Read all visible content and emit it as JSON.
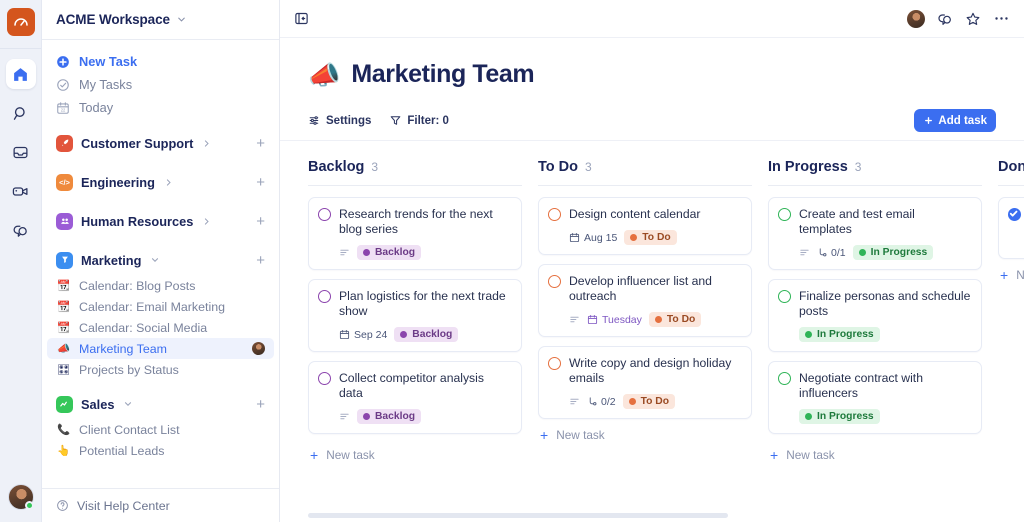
{
  "brand": {
    "logo_color": "#d4551d",
    "logo_icon": "speedometer-icon"
  },
  "rail": {
    "items": [
      {
        "name": "home-icon",
        "label": "Home",
        "active": true
      },
      {
        "name": "search-icon",
        "label": "Search",
        "active": false
      },
      {
        "name": "inbox-icon",
        "label": "Inbox",
        "active": false
      },
      {
        "name": "clips-video-icon",
        "label": "Clips",
        "active": false
      },
      {
        "name": "chat-help-icon",
        "label": "Chat",
        "active": false
      }
    ]
  },
  "sidebar": {
    "workspace": {
      "name": "ACME Workspace",
      "chevron": "chevron-down-icon"
    },
    "quick_links": [
      {
        "label": "New Task",
        "icon": "plus-circle-icon",
        "accent": true
      },
      {
        "label": "My Tasks",
        "icon": "check-circle-icon",
        "accent": false
      },
      {
        "label": "Today",
        "icon": "calendar-icon",
        "accent": false
      }
    ],
    "spaces": [
      {
        "label": "Customer Support",
        "icon_glyph": "✈",
        "icon_color": "#e2553c",
        "expanded": false,
        "chevron": "chevron-right-icon",
        "children": []
      },
      {
        "label": "Engineering",
        "icon_glyph": "</>",
        "icon_color": "#ef8a3c",
        "expanded": false,
        "chevron": "chevron-right-icon",
        "children": []
      },
      {
        "label": "Human Resources",
        "icon_glyph": "⚇",
        "icon_color": "#9b5cd6",
        "expanded": false,
        "chevron": "chevron-right-icon",
        "children": []
      },
      {
        "label": "Marketing",
        "icon_glyph": "⚐",
        "icon_color": "#3b8ef0",
        "expanded": true,
        "chevron": "chevron-down-icon",
        "children": [
          {
            "label": "Calendar: Blog Posts",
            "emoji": "📆",
            "selected": false,
            "avatar": false
          },
          {
            "label": "Calendar: Email Marketing",
            "emoji": "📆",
            "selected": false,
            "avatar": false
          },
          {
            "label": "Calendar: Social Media",
            "emoji": "📆",
            "selected": false,
            "avatar": false
          },
          {
            "label": "Marketing Team",
            "emoji": "📣",
            "selected": true,
            "avatar": true
          },
          {
            "label": "Projects by Status",
            "emoji": "🎛",
            "selected": false,
            "avatar": false
          }
        ]
      },
      {
        "label": "Sales",
        "icon_glyph": "〜",
        "icon_color": "#35c75a",
        "expanded": true,
        "chevron": "chevron-down-icon",
        "children": [
          {
            "label": "Client Contact List",
            "emoji": "📞",
            "selected": false,
            "avatar": false
          },
          {
            "label": "Potential Leads",
            "emoji": "👆",
            "selected": false,
            "avatar": false
          }
        ]
      }
    ],
    "footer": {
      "label": "Visit Help Center",
      "icon": "question-circle-icon"
    }
  },
  "topbar": {
    "collapse_icon": "collapse-sidebar-icon",
    "actions": [
      {
        "name": "avatar",
        "label": "User avatar"
      },
      {
        "name": "comment-icon",
        "label": "Comments"
      },
      {
        "name": "star-icon",
        "label": "Favorite"
      },
      {
        "name": "more-options-icon",
        "label": "More"
      }
    ]
  },
  "page": {
    "emoji": "📣",
    "title": "Marketing Team"
  },
  "toolbar": {
    "settings_label": "Settings",
    "settings_icon": "sliders-icon",
    "filter_label": "Filter: 0",
    "filter_icon": "funnel-icon",
    "add_task_label": "Add task",
    "add_task_icon": "plus-icon",
    "accent_color": "#3b6ef0"
  },
  "board": {
    "new_task_label": "New task",
    "columns": [
      {
        "name": "Backlog",
        "count": "3",
        "status_key": "backlog",
        "accent": "#8b44ad",
        "cards": [
          {
            "title": "Research trends for the next blog series",
            "has_description": true,
            "date": "",
            "date_violet": false,
            "subtasks": "",
            "badge": "Backlog"
          },
          {
            "title": "Plan logistics for the next trade show",
            "has_description": false,
            "date": "Sep 24",
            "date_violet": false,
            "subtasks": "",
            "badge": "Backlog"
          },
          {
            "title": "Collect competitor analysis data",
            "has_description": true,
            "date": "",
            "date_violet": false,
            "subtasks": "",
            "badge": "Backlog"
          }
        ]
      },
      {
        "name": "To Do",
        "count": "3",
        "status_key": "todo",
        "accent": "#e5703f",
        "cards": [
          {
            "title": "Design content calendar",
            "has_description": false,
            "date": "Aug 15",
            "date_violet": false,
            "subtasks": "",
            "badge": "To Do"
          },
          {
            "title": "Develop influencer list and outreach",
            "has_description": true,
            "date": "Tuesday",
            "date_violet": true,
            "subtasks": "",
            "badge": "To Do"
          },
          {
            "title": "Write copy and design holiday emails",
            "has_description": true,
            "date": "",
            "date_violet": false,
            "subtasks": "0/2",
            "badge": "To Do"
          }
        ]
      },
      {
        "name": "In Progress",
        "count": "3",
        "status_key": "prog",
        "accent": "#2fb457",
        "cards": [
          {
            "title": "Create and test email templates",
            "has_description": true,
            "date": "",
            "date_violet": false,
            "subtasks": "0/1",
            "badge": "In Progress"
          },
          {
            "title": "Finalize personas and schedule posts",
            "has_description": false,
            "date": "",
            "date_violet": false,
            "subtasks": "",
            "badge": "In Progress"
          },
          {
            "title": "Negotiate contract with influencers",
            "has_description": false,
            "date": "",
            "date_violet": false,
            "subtasks": "",
            "badge": "In Progress"
          }
        ]
      },
      {
        "name": "Done",
        "count": "",
        "status_key": "done",
        "accent": "#3b6ef0",
        "cards": [
          {
            "title": "",
            "has_description": false,
            "date": "",
            "date_violet": false,
            "subtasks": "",
            "badge": ""
          }
        ]
      }
    ]
  }
}
